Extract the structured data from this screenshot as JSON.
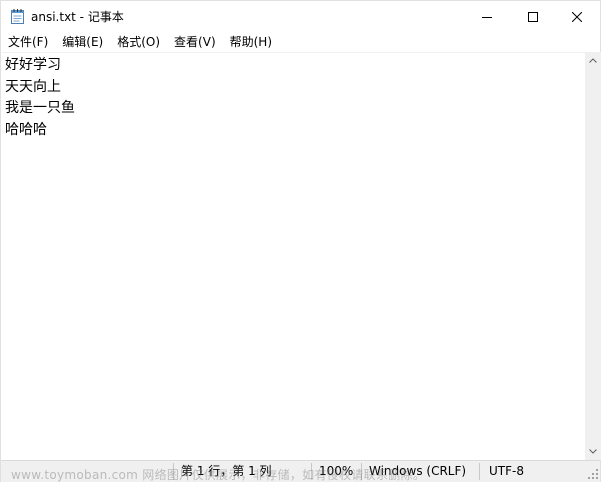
{
  "window": {
    "title": "ansi.txt - 记事本"
  },
  "menu": {
    "items": [
      {
        "label": "文件(F)"
      },
      {
        "label": "编辑(E)"
      },
      {
        "label": "格式(O)"
      },
      {
        "label": "查看(V)"
      },
      {
        "label": "帮助(H)"
      }
    ]
  },
  "editor": {
    "lines": [
      "好好学习",
      "天天向上",
      "我是一只鱼",
      "哈哈哈"
    ]
  },
  "status": {
    "position": "第 1 行，第 1 列",
    "zoom": "100%",
    "line_ending": "Windows (CRLF)",
    "encoding": "UTF-8"
  },
  "watermark": {
    "text": "www.toymoban.com 网络图片仅供展示，非存储，如有侵权请联系删除。"
  },
  "icons": {
    "app": "notepad-icon",
    "minimize": "minimize-icon",
    "maximize": "maximize-icon",
    "close": "close-icon"
  }
}
